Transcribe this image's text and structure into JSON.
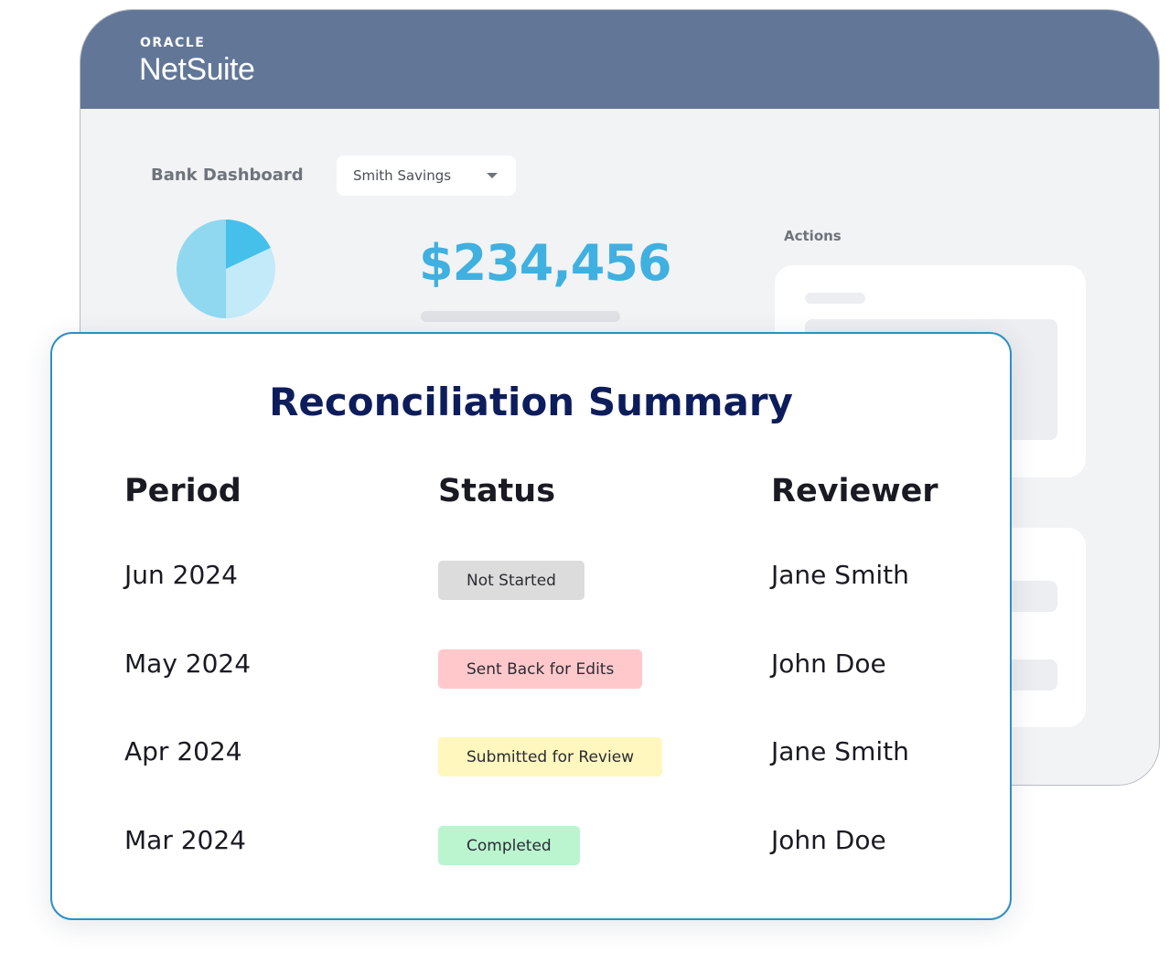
{
  "app": {
    "brand_top": "ORACLE",
    "brand_name": "NetSuite",
    "dashboard_title": "Bank Dashboard",
    "account_select": {
      "value": "Smith Savings"
    },
    "balance": "$234,456",
    "actions_label": "Actions",
    "pie": {
      "slices": [
        0.18,
        0.32,
        0.5
      ],
      "colors": [
        "#45c0ea",
        "#c3eaf8",
        "#8fd8f0"
      ]
    }
  },
  "summary": {
    "title": "Reconciliation Summary",
    "columns": [
      "Period",
      "Status",
      "Reviewer"
    ],
    "rows": [
      {
        "period": "Jun 2024",
        "status": "Not Started",
        "status_color": "#dcdcdc",
        "reviewer": "Jane Smith"
      },
      {
        "period": "May 2024",
        "status": "Sent Back for Edits",
        "status_color": "#ffc9cb",
        "reviewer": "John Doe"
      },
      {
        "period": "Apr 2024",
        "status": "Submitted for Review",
        "status_color": "#fff7be",
        "reviewer": "Jane Smith"
      },
      {
        "period": "Mar 2024",
        "status": "Completed",
        "status_color": "#baf5d0",
        "reviewer": "John Doe"
      }
    ]
  }
}
